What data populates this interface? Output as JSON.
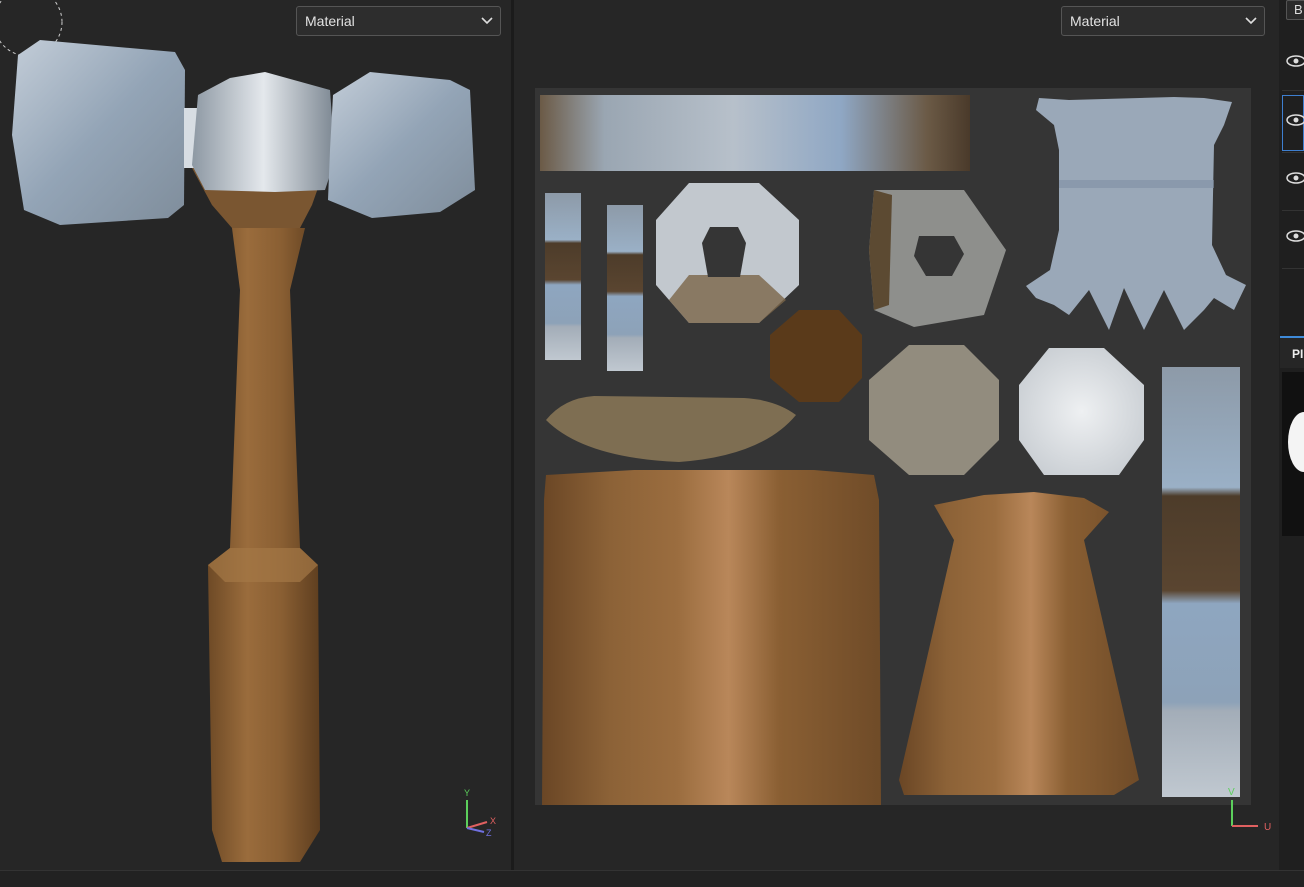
{
  "viewport_3d": {
    "dropdown": {
      "label": "Material",
      "icon": "chevron-down-icon"
    },
    "axis_gizmo": {
      "y": "Y",
      "x": "X",
      "z": "Z"
    }
  },
  "viewport_2d": {
    "dropdown": {
      "label": "Material",
      "icon": "chevron-down-icon"
    },
    "axis_gizmo": {
      "v": "V",
      "u": "U"
    }
  },
  "right_panel": {
    "top_button": "B",
    "layers": [
      {
        "icon": "eye-icon",
        "selected": false
      },
      {
        "icon": "eye-icon",
        "selected": true
      },
      {
        "icon": "eye-icon",
        "selected": false
      },
      {
        "icon": "eye-icon",
        "selected": false
      }
    ],
    "properties_tab": "PI"
  },
  "colors": {
    "accent": "#3e8ad8",
    "background": "#262626",
    "wood": "#8a6238",
    "metal": "#a9b4bf"
  }
}
